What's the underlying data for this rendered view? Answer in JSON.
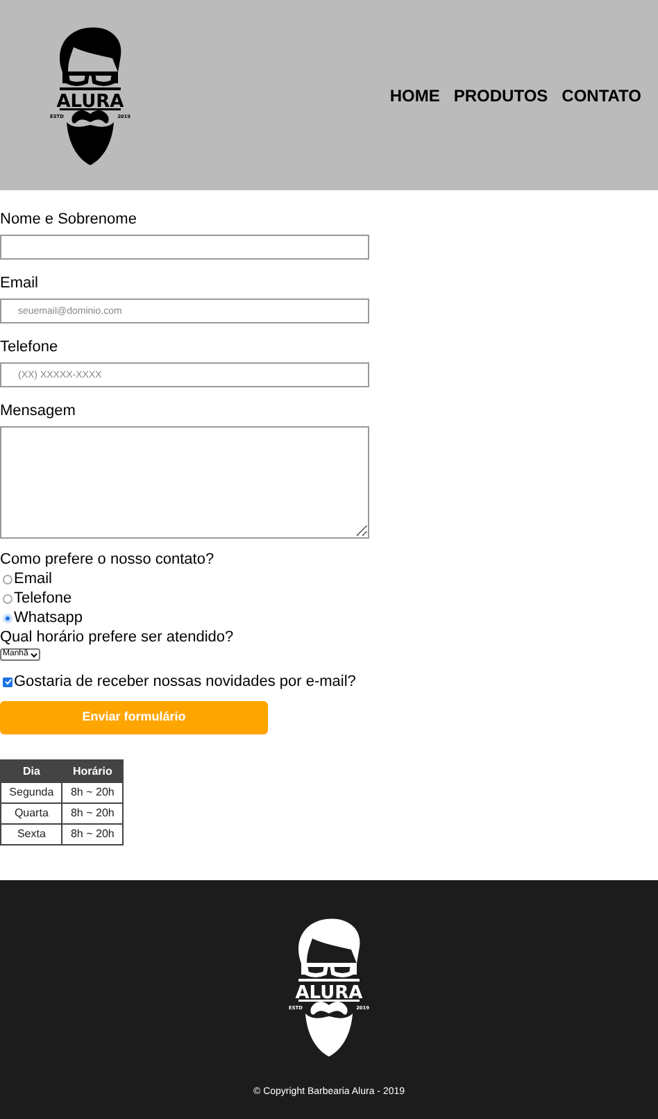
{
  "header": {
    "logo": {
      "word": "ALURA",
      "left_mark": "ESTD",
      "right_mark": "2019"
    },
    "nav": [
      "HOME",
      "PRODUTOS",
      "CONTATO"
    ]
  },
  "form": {
    "fields": [
      {
        "kind": "text",
        "label": "Nome e Sobrenome"
      },
      {
        "kind": "text",
        "label": "Email",
        "placeholder": "seuemail@dominio.com"
      },
      {
        "kind": "text",
        "label": "Telefone",
        "placeholder": "(XX) XXXXX-XXXX"
      },
      {
        "kind": "textarea",
        "label": "Mensagem"
      }
    ],
    "contact_question": "Como prefere o nosso contato?",
    "contact_options": [
      {
        "label": "Email",
        "selected": false
      },
      {
        "label": "Telefone",
        "selected": false
      },
      {
        "label": "Whatsapp",
        "selected": true
      }
    ],
    "time_question": "Qual horário prefere ser atendido?",
    "time_select": "Manhã",
    "newsletter": {
      "label": "Gostaria de receber nossas novidades por e-mail?",
      "checked": true
    },
    "submit": "Enviar formulário"
  },
  "schedule": {
    "columns": [
      "Dia",
      "Horário"
    ],
    "rows": [
      [
        "Segunda",
        "8h ~ 20h"
      ],
      [
        "Quarta",
        "8h ~ 20h"
      ],
      [
        "Sexta",
        "8h ~ 20h"
      ]
    ]
  },
  "footer": {
    "logo": {
      "word": "ALURA",
      "left_mark": "ESTD",
      "right_mark": "2019"
    },
    "copyright": "© Copyright Barbearia Alura - 2019"
  }
}
